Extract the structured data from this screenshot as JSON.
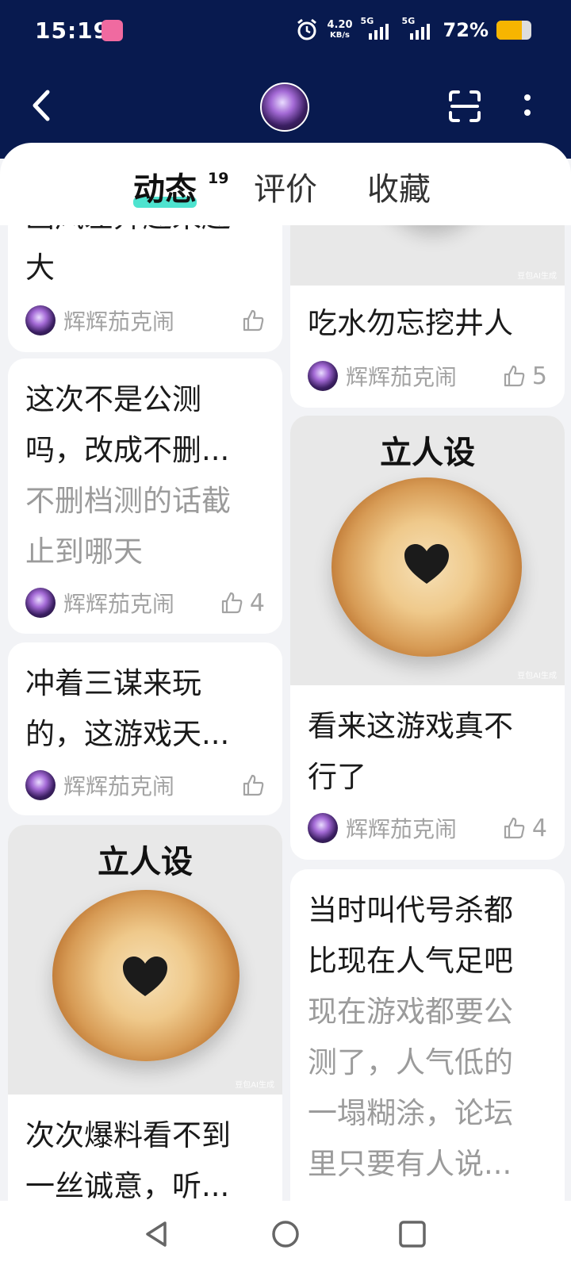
{
  "status_bar": {
    "time": "15:19",
    "net_speed_value": "4.20",
    "net_speed_unit": "KB/s",
    "sig1_label": "5G",
    "sig2_label": "5G",
    "battery_percent": "72%",
    "battery_level": 0.72
  },
  "nav": {
    "back_icon": "chevron-left-icon",
    "scan_icon": "scan-icon",
    "more_icon": "more-vertical-icon"
  },
  "tabs": [
    {
      "label": "动态",
      "count": "19",
      "active": true
    },
    {
      "label": "评价",
      "active": false
    },
    {
      "label": "收藏",
      "active": false
    }
  ],
  "feed": {
    "left": [
      {
        "title_partial": "画风差异越来越",
        "title_end": "大",
        "author": "辉辉茄克闹",
        "likes": ""
      },
      {
        "title": [
          "这次不是公测",
          "吗，改成不删..."
        ],
        "subtitle": [
          "不删档测的话截",
          "止到哪天"
        ],
        "author": "辉辉茄克闹",
        "likes": "4"
      },
      {
        "title": [
          "冲着三谋来玩",
          "的，这游戏天..."
        ],
        "author": "辉辉茄克闹",
        "likes": ""
      },
      {
        "image_caption": "立人设",
        "watermark": "豆包AI生成",
        "title": [
          "次次爆料看不到",
          "一丝诚意，听..."
        ]
      }
    ],
    "right": [
      {
        "watermark": "豆包AI生成",
        "title": [
          "吃水勿忘挖井人"
        ],
        "author": "辉辉茄克闹",
        "likes": "5"
      },
      {
        "image_caption": "立人设",
        "watermark": "豆包AI生成",
        "title": [
          "看来这游戏真不",
          "行了"
        ],
        "author": "辉辉茄克闹",
        "likes": "4"
      },
      {
        "title": [
          "当时叫代号杀都",
          "比现在人气足吧"
        ],
        "subtitle": [
          "现在游戏都要公",
          "测了，人气低的",
          "一塌糊涂，论坛",
          "里只要有人说..."
        ]
      }
    ]
  },
  "system_nav": {
    "back": "triangle-back-icon",
    "home": "circle-home-icon",
    "recents": "square-recents-icon"
  }
}
